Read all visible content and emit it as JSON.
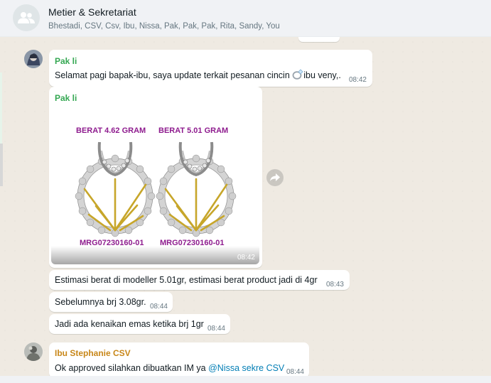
{
  "header": {
    "title": "Metier & Sekretariat",
    "members": "Bhestadi, CSV, Csv, Ibu, Nissa, Pak, Pak, Pak, Rita, Sandy, You",
    "avatar_icon": "group-icon"
  },
  "messages": [
    {
      "sender": "Pak li",
      "sender_color": "#35a853",
      "text_before_emoji": "Selamat pagi bapak-ibu, saya update terkait pesanan cincin ",
      "emoji": "ring-emoji",
      "text_after_emoji": "ibu veny,.",
      "time": "08:42"
    },
    {
      "sender": "Pak li",
      "type": "image",
      "image": {
        "left_weight": "BERAT 4.62 GRAM",
        "right_weight": "BERAT 5.01 GRAM",
        "left_code": "MRG07230160-01",
        "right_code": "MRG07230160-01"
      },
      "time": "08:42"
    },
    {
      "text": "Estimasi berat di modeller 5.01gr, estimasi berat product jadi di 4gr",
      "time": "08:43"
    },
    {
      "text": "Sebelumnya brj 3.08gr.",
      "time": "08:44"
    },
    {
      "text": "Jadi ada kenaikan emas ketika brj 1gr",
      "time": "08:44"
    },
    {
      "sender": "Ibu Stephanie CSV",
      "sender_color": "#c88719",
      "text": "Ok approved silahkan dibuatkan IM ya ",
      "mention": "@Nissa sekre CSV",
      "time": "08:44"
    }
  ],
  "icons": {
    "forward": "forward-icon"
  }
}
